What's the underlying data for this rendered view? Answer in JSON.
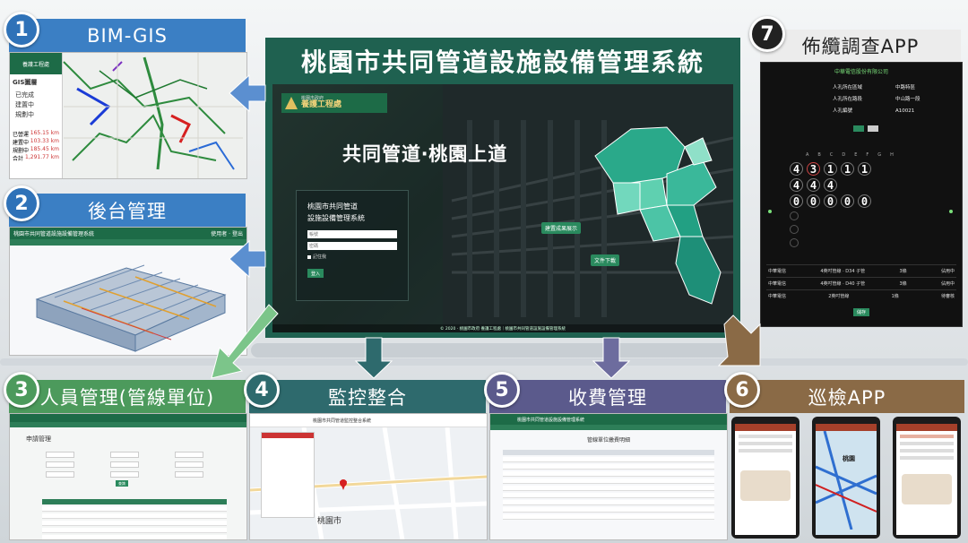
{
  "center": {
    "title": "桃園市共同管道設施設備管理系統",
    "logo_small": "桃園市政府",
    "logo_big": "養護工程處",
    "slogan": "共同管道‧桃園上道",
    "login_title_1": "桃園市共同管道",
    "login_title_2": "設施設備管理系統",
    "login_user_placeholder": "帳號",
    "login_pass_placeholder": "密碼",
    "remember": "記住我",
    "login_button": "登入",
    "map_btn_1": "建置成果展示",
    "map_btn_2": "文件下載",
    "footer": "© 2020 · 桃園市政府 養護工程處｜桃園市共同管道設施設備管理系統"
  },
  "modules": [
    {
      "num": "1",
      "title": "BIM-GIS"
    },
    {
      "num": "2",
      "title": "後台管理"
    },
    {
      "num": "3",
      "title": "人員管理(管線單位)"
    },
    {
      "num": "4",
      "title": "監控整合"
    },
    {
      "num": "5",
      "title": "收費管理"
    },
    {
      "num": "6",
      "title": "巡檢APP"
    },
    {
      "num": "7",
      "title": "佈纜調查APP"
    }
  ],
  "gis": {
    "panel_title": "GIS圖層",
    "legend": [
      "已完成",
      "建置中",
      "規劃中"
    ],
    "stats": [
      [
        "已營運",
        "165.15 km"
      ],
      [
        "建置中",
        "103.33 km"
      ],
      [
        "規劃中",
        "185.45 km"
      ],
      [
        "合計",
        "1,291.77 km"
      ]
    ]
  },
  "backend": {
    "app_name": "桃園市共同管道設施設備管理系統",
    "user": "使用者",
    "logout": "登出"
  },
  "personnel": {
    "heading": "申請管理",
    "search": "查詢"
  },
  "monitor": {
    "header": "桃園市共同管道監控整合系統",
    "city": "桃園市"
  },
  "fee": {
    "app_name": "桃園市共同管道設施設備管理系統",
    "table_title": "管線單位繳費明細"
  },
  "cable": {
    "company": "中華電信股份有限公司",
    "rows": [
      [
        "人孔所在區域",
        "中路特區"
      ],
      [
        "人孔所在路段",
        "中山路一段"
      ],
      [
        "人孔編號",
        "A10021"
      ]
    ],
    "grid_rows": [
      [
        "4",
        "3",
        "1",
        "1",
        "1"
      ],
      [
        "4",
        "4",
        "4"
      ],
      [
        "0",
        "0",
        "0",
        "0",
        "0"
      ]
    ],
    "col_labels": [
      "A",
      "B",
      "C",
      "D",
      "E",
      "F",
      "G",
      "H"
    ],
    "list": [
      [
        "中華電信",
        "4英吋管線 · D34 子管",
        "3條",
        "佔用中"
      ],
      [
        "中華電信",
        "4英吋管線 · D40 子管",
        "3條",
        "佔用中"
      ],
      [
        "中華電信",
        "2英吋管線",
        "1條",
        "待審核"
      ]
    ],
    "save": "儲存"
  },
  "inspect": {
    "city": "桃園"
  },
  "colors": {
    "green": "#1d6b47",
    "blue_hdr": "#3b7fc4",
    "center_border": "#1f6150",
    "brown": "#8a6a46",
    "purple": "#5b5a8c",
    "teal": "#2e6a6d"
  }
}
